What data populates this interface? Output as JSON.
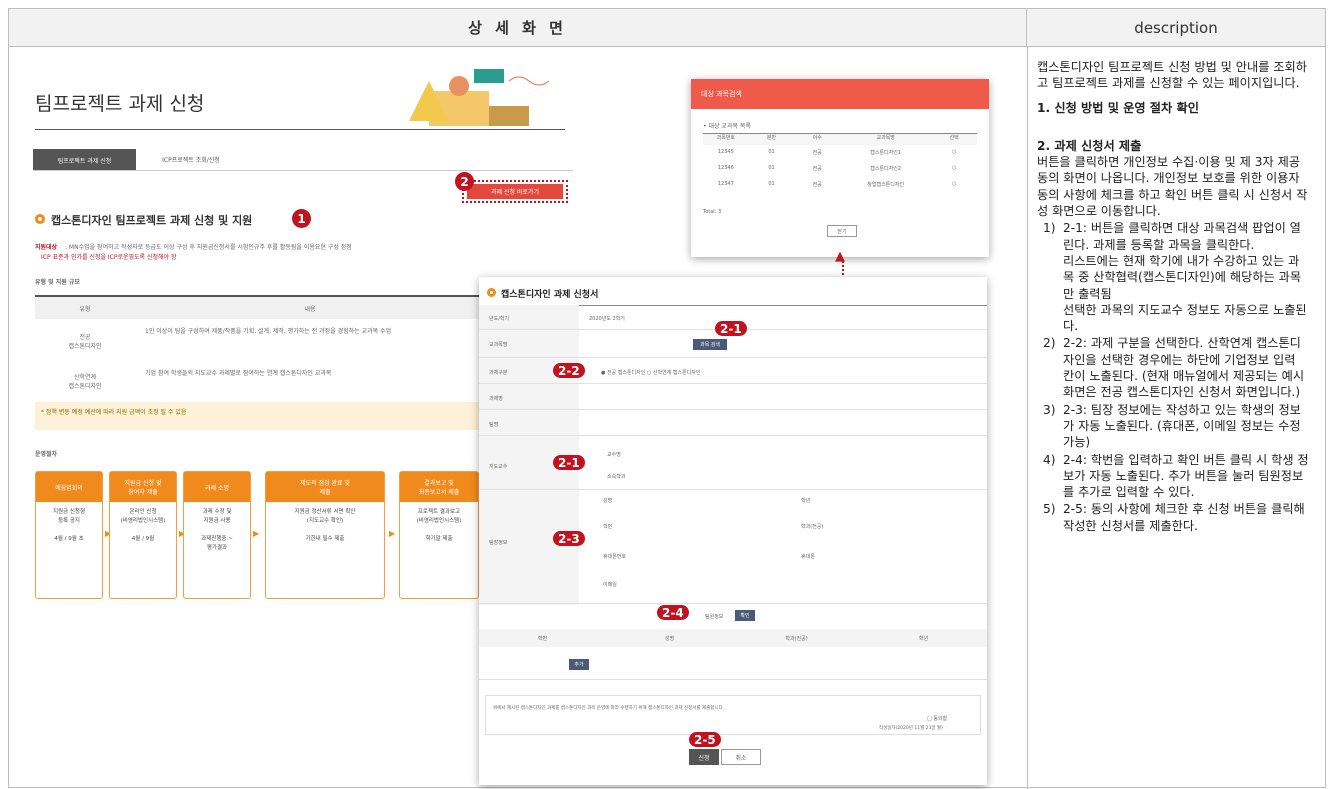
{
  "header": {
    "left": "상 세 화 면",
    "right": "description"
  },
  "description": {
    "intro": "캡스톤디자인 팀프로젝트 신청 방법 및 안내를 조회하고 팀프로젝트 과제를 신청할 수 있는 페이지입니다.",
    "sec1": "1. 신청 방법 및 운영 절차 확인",
    "sec2": "2. 과제 신청서 제출",
    "sec2_body": "버튼을 클릭하면 개인정보 수집·이용 및 제 3자 제공 동의 화면이 나옵니다. 개인정보 보호를 위한 이용자 동의 사항에 체크를 하고 확인 버튼 클릭 시 신청서 작성 화면으로 이동합니다.",
    "items": [
      {
        "num": "1)",
        "text": "2-1: 버튼을 클릭하면 대상 과목검색 팝업이 열린다. 과제를 등록할 과목을 클릭한다.",
        "sub": "리스트에는 현재 학기에 내가 수강하고 있는 과목 중 산학협력(캡스톤디자인)에 해당하는 과목만 출력됨",
        "sub2": "선택한 과목의 지도교수 정보도 자동으로 노출된다."
      },
      {
        "num": "2)",
        "text": "2-2: 과제 구분을 선택한다. 산학연계 캡스톤디자인을 선택한 경우에는 하단에 기업정보 입력 칸이 노출된다. (현재 매뉴얼에서 제공되는 예시화면은 전공 캡스톤디자인 신청서 화면입니다.)"
      },
      {
        "num": "3)",
        "text": "2-3: 팀장 정보에는 작성하고 있는 학생의 정보가 자동 노출된다. (휴대폰, 이메일 정보는 수정 가능)"
      },
      {
        "num": "4)",
        "text": "2-4: 학번을 입력하고 확인 버튼 클릭 시 학생 정보가 자동 노출된다. 추가 버튼을 눌러 팀원정보를 추가로 입력할 수 있다."
      },
      {
        "num": "5)",
        "text": "2-5: 동의 사항에 체크한 후 신청 버튼을 클릭해 작성한 신청서를 제출한다."
      }
    ]
  },
  "mock": {
    "page_title": "팀프로젝트 과제 신청",
    "tab_active": "팀프로젝트 과제 신청",
    "tab_other": "ICP프로젝트 조회/신청",
    "apply_btn": "과제 신청 바로가기",
    "section_title": "캡스톤디자인 팀프로젝트 과제 신청 및 지원",
    "target_label": "지원대상",
    "target_text": ": MN수업을 참여하고 작성자로 등급도 이상 구성 후 지원금신청서를 시험인규주 후를 활동됨을 이용요현 구성 정점",
    "target_note": "ICP 표준과 인가를 신청을 ICP로운영도록 신청해야 함",
    "type_title": "유형 및 지원 규모",
    "table_head": [
      "유형",
      "내용"
    ],
    "table_rows": [
      [
        "전공\n캡스톤디자인",
        "1인 이상이 팀을 구성하여 제품/작품을 기획, 설계, 제작, 평가하는 전 과정을 경험하는 교과목 수업"
      ],
      [
        "산학연계\n캡스톤디자인",
        "기업 참여 학생들의 지도교수 과제별로 참여하는 연계 캡스톤디자인 교과목"
      ]
    ],
    "note": "* 정책 변동 예정 예산에 따라 지원 금액이 조정 될 수 있음",
    "flow_title": "운영절차",
    "flow": [
      {
        "h": "예창업회의",
        "b": "지원금 신청형\n등록 공지\n\n4월 / 9월 초"
      },
      {
        "h": "지원금 신청 및\n참여자 제출",
        "b": "온라인 신청\n(비영리법인시스템)\n\n4월 / 9월"
      },
      {
        "h": "과제 소명",
        "b": "과제 수정 및\n지원금 사용\n\n과제진행중 ~\n평가결과"
      },
      {
        "h": "제도적 점검 완료 및\n제출",
        "b": "지원금 정산서류 서면 확인\n(지도교수 확인)\n\n기한내 필수 제출"
      },
      {
        "h": "결과보고 및\n최종보고서 제출",
        "b": "프로젝트 결과보고\n(비영리법인시스템)\n\n학기말 제출"
      }
    ],
    "popup_title": "대상 과목검색",
    "popup_sub": "• 대상 교과목 목록",
    "popup_cols": [
      "과목번호",
      "분반",
      "이수",
      "교과목명",
      "선택"
    ],
    "popup_rows": [
      [
        "12345",
        "01",
        "전공",
        "캡스톤디자인1",
        "○"
      ],
      [
        "12346",
        "01",
        "전공",
        "캡스톤디자인2",
        "○"
      ],
      [
        "12347",
        "01",
        "전공",
        "창업캡스톤디자인",
        "○"
      ]
    ],
    "popup_count": "Total: 3",
    "popup_close": "닫기",
    "form_title": "캡스톤디자인 과제 신청서",
    "form_labels": [
      "년도/학기",
      "교과목명",
      "과제구분",
      "과제명",
      "팀명",
      "지도교수",
      "팀장정보"
    ],
    "form_year": "2020년도 2학기",
    "form_search_btn": "과목 검색",
    "form_type_opts": "● 전공 캡스톤디자인   ○ 산학연계 캡스톤디자인",
    "prof_fields": [
      "교수명",
      "소속학과"
    ],
    "leader_fields": [
      "성명",
      "학번",
      "휴대폰번호",
      "이메일"
    ],
    "leader_fields2": [
      "학년",
      "학과(전공)",
      "휴대폰"
    ],
    "member_label": "팀원정보",
    "member_btn": "확인",
    "member_cols": [
      "학번",
      "성명",
      "학과(전공)",
      "학년"
    ],
    "add_btn": "추가",
    "agree_text": "위에서 제시된 캡스톤디자인 과제를 캡스톤디자인 과목 운영에 따라 수행하기 위해 캡스톤디자인 과제 신청서를 제출합니다.",
    "agree_chk": "□ 동의함",
    "agree_date": "작성일자(2020년 11월 23일 월)",
    "submit_btn": "신청",
    "cancel_btn": "취소",
    "badges": {
      "b1": "1",
      "b2": "2",
      "b21": "2-1",
      "b22": "2-2",
      "b21b": "2-1",
      "b23": "2-3",
      "b24": "2-4",
      "b25": "2-5"
    }
  },
  "colors": {
    "accent": "#c1121f",
    "orange": "#f08a1c",
    "popup_header": "#f05a4a",
    "dark_button": "#4a5a78"
  }
}
